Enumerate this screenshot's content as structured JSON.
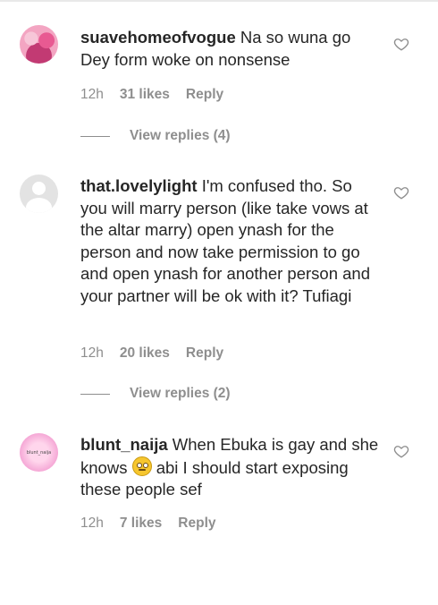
{
  "comments": [
    {
      "username": "suavehomeofvogue",
      "text": "Na so wuna go Dey form woke on nonsense",
      "time": "12h",
      "likes": "31 likes",
      "reply_label": "Reply",
      "view_replies": "View replies (4)"
    },
    {
      "username": "that.lovelylight",
      "text": "I'm confused tho. So you will marry person (like take vows at the altar marry) open ynash for the person and now take permission to go and open ynash for another person and your partner will be ok with it? Tufiagi",
      "time": "12h",
      "likes": "20 likes",
      "reply_label": "Reply",
      "view_replies": "View replies (2)"
    },
    {
      "username": "blunt_naija",
      "text_before_emoji": "When Ebuka is gay and she knows",
      "emoji": "face-with-rolling-eyes-emoji",
      "text_after_emoji": "abi I should start exposing these people sef",
      "avatar_text": "blunt_naija",
      "time": "12h",
      "likes": "7 likes",
      "reply_label": "Reply"
    }
  ],
  "icons": {
    "like": "heart-outline-icon"
  },
  "colors": {
    "text": "#262626",
    "secondary": "#8e8e8e",
    "avatar_placeholder": "#e3e3e3"
  }
}
